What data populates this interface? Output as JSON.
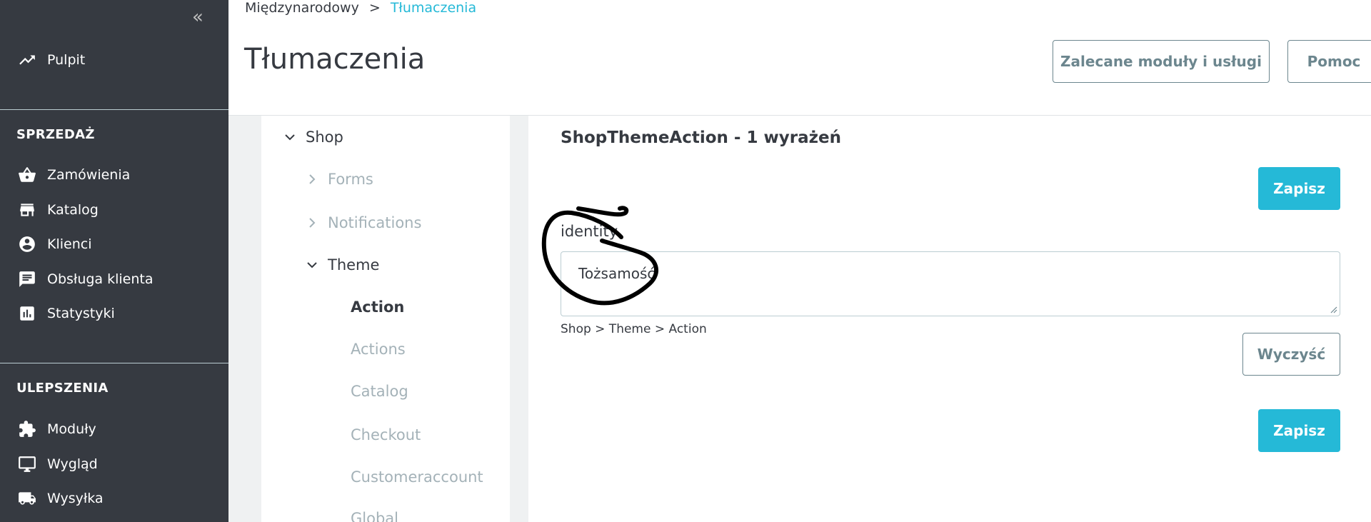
{
  "sidebar": {
    "collapse_icon": "«",
    "dashboard": {
      "label": "Pulpit",
      "icon": "trending-up-icon"
    },
    "sales_section": "SPRZEDAŻ",
    "sales_items": [
      {
        "label": "Zamówienia",
        "icon": "shopping-basket-icon"
      },
      {
        "label": "Katalog",
        "icon": "store-icon"
      },
      {
        "label": "Klienci",
        "icon": "account-circle-icon"
      },
      {
        "label": "Obsługa klienta",
        "icon": "chat-icon"
      },
      {
        "label": "Statystyki",
        "icon": "bar-chart-icon"
      }
    ],
    "improve_section": "ULEPSZENIA",
    "improve_items": [
      {
        "label": "Moduły",
        "icon": "puzzle-icon"
      },
      {
        "label": "Wygląd",
        "icon": "monitor-icon"
      },
      {
        "label": "Wysyłka",
        "icon": "truck-icon"
      }
    ]
  },
  "header": {
    "breadcrumb_parent": "Międzynarodowy",
    "breadcrumb_separator": ">",
    "breadcrumb_current": "Tłumaczenia",
    "title": "Tłumaczenia",
    "recommended_button": "Zalecane moduły i usługi",
    "help_button": "Pomoc"
  },
  "tree": {
    "root": "Shop",
    "forms": "Forms",
    "notifications": "Notifications",
    "theme": "Theme",
    "children": {
      "action": "Action",
      "actions": "Actions",
      "catalog": "Catalog",
      "checkout": "Checkout",
      "customeraccount": "Customeraccount",
      "global": "Global"
    }
  },
  "detail": {
    "domain_title": "ShopThemeAction - 1 wyrażeń",
    "save_button": "Zapisz",
    "field_label": "identity",
    "field_value": "Tożsamość",
    "field_path": "Shop > Theme > Action",
    "clear_button": "Wyczyść"
  },
  "colors": {
    "sidebar_bg": "#363a41",
    "accent": "#25b9d7",
    "muted": "#a4b2b8",
    "outline": "#6c868e"
  }
}
